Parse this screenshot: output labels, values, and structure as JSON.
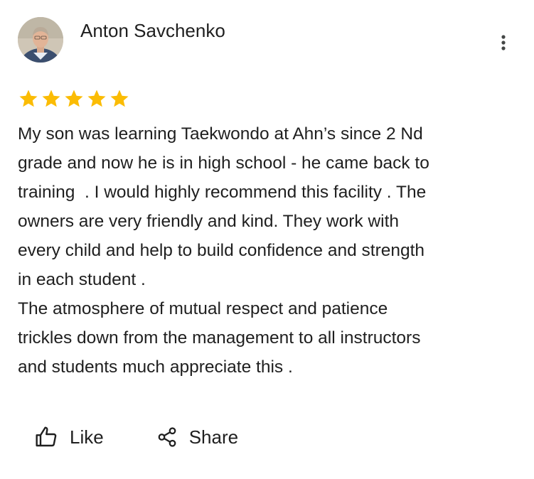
{
  "review": {
    "author_name": "Anton Savchenko",
    "rating": 5,
    "rating_max": 5,
    "star_color": "#fbbc04",
    "text": "My son was learning Taekwondo at Ahn’s since 2 Nd\ngrade and now he is in high school - he came back to\ntraining  . I would highly recommend this facility . The\nowners are very friendly and kind. They work with\nevery child and help to build confidence and strength\nin each student .\nThe atmosphere of mutual respect and patience\ntrickles down from the management to all instructors\nand students much appreciate this ."
  },
  "menu": {
    "icon": "more-vert-icon"
  },
  "actions": {
    "like_label": "Like",
    "like_icon": "thumb-up-icon",
    "share_label": "Share",
    "share_icon": "share-icon"
  }
}
